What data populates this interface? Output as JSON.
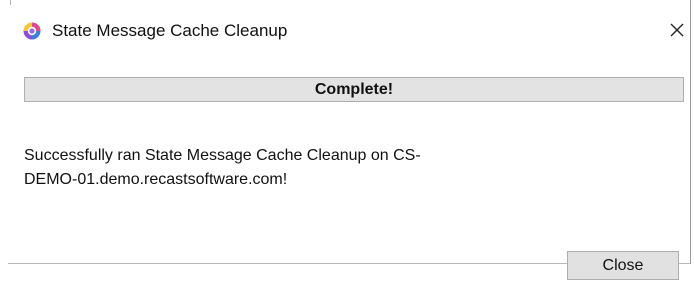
{
  "window": {
    "title": "State Message Cache Cleanup",
    "app_icon": "recast-app-icon",
    "close_icon": "close-icon"
  },
  "status": {
    "banner_text": "Complete!"
  },
  "message": {
    "line1": "Successfully ran State Message Cache Cleanup on CS-",
    "line2": "DEMO-01.demo.recastsoftware.com!"
  },
  "buttons": {
    "close_label": "Close"
  },
  "colors": {
    "banner_bg": "#e3e3e3",
    "button_bg": "#e1e1e1",
    "icon_yellow": "#f3c53a",
    "icon_purple": "#8a4fd8",
    "icon_blue": "#3d7fd8"
  }
}
